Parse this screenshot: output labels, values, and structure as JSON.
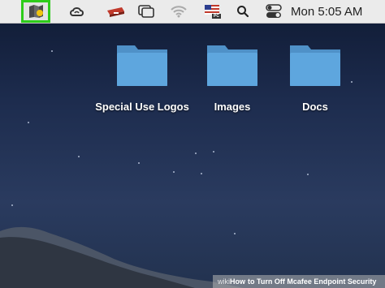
{
  "menubar": {
    "items": [
      {
        "name": "mcafee-icon"
      },
      {
        "name": "creative-cloud-icon"
      },
      {
        "name": "drive-icon"
      },
      {
        "name": "window-icon"
      },
      {
        "name": "wifi-icon"
      },
      {
        "name": "flag-input-icon",
        "badge": "PC"
      },
      {
        "name": "search-icon"
      },
      {
        "name": "toggle-icon"
      }
    ],
    "clock": "Mon 5:05 AM",
    "highlight_color": "#2ecc1a"
  },
  "desktop": {
    "folders": [
      {
        "label": "Special Use Logos"
      },
      {
        "label": "Images"
      },
      {
        "label": "Docs"
      }
    ],
    "folder_color": "#5aa3dc"
  },
  "footer": {
    "wiki": "wiki",
    "how": "How",
    "title": "to Turn Off Mcafee Endpoint Security"
  }
}
